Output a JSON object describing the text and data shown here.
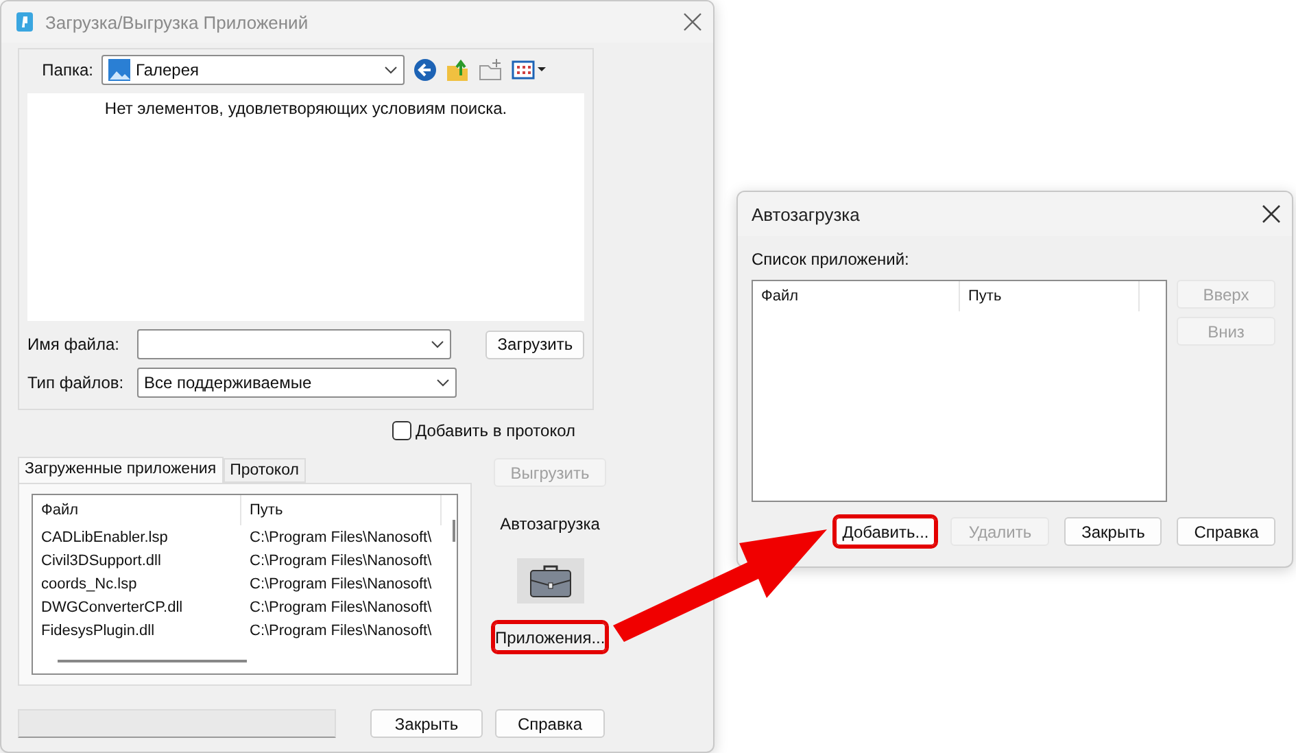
{
  "main_window": {
    "title": "Загрузка/Выгрузка Приложений",
    "folder": {
      "label": "Папка:",
      "value": "Галерея"
    },
    "empty_message": "Нет элементов, удовлетворяющих условиям поиска.",
    "file_name": {
      "label": "Имя файла:"
    },
    "load_button": "Загрузить",
    "file_type": {
      "label": "Тип файлов:",
      "value": "Все поддерживаемые"
    },
    "add_to_log": {
      "label": "Добавить в протокол",
      "checked": false
    },
    "tabs": [
      {
        "label": "Загруженные приложения",
        "selected": true
      },
      {
        "label": "Протокол",
        "selected": false
      }
    ],
    "table": {
      "columns": [
        "Файл",
        "Путь"
      ],
      "rows": [
        {
          "file": "CADLibEnabler.lsp",
          "path": "C:\\Program Files\\Nanosoft\\"
        },
        {
          "file": "Civil3DSupport.dll",
          "path": "C:\\Program Files\\Nanosoft\\"
        },
        {
          "file": "coords_Nc.lsp",
          "path": "C:\\Program Files\\Nanosoft\\"
        },
        {
          "file": "DWGConverterCP.dll",
          "path": "C:\\Program Files\\Nanosoft\\"
        },
        {
          "file": "FidesysPlugin.dll",
          "path": "C:\\Program Files\\Nanosoft\\"
        }
      ]
    },
    "unload_button": {
      "label": "Выгрузить",
      "disabled": true
    },
    "autoload_label": "Автозагрузка",
    "apps_button": {
      "label": "Приложения...",
      "highlighted": true
    },
    "progress": {
      "level": 0
    },
    "buttons": [
      "Закрыть",
      "Справка"
    ]
  },
  "autoload_window": {
    "title": "Автозагрузка",
    "list_label": "Список приложений:",
    "columns": [
      "Файл",
      "Путь"
    ],
    "side_buttons": [
      {
        "label": "Вверх",
        "disabled": true
      },
      {
        "label": "Вниз",
        "disabled": true
      }
    ],
    "buttons": [
      {
        "label": "Добавить...",
        "disabled": false,
        "highlighted": true
      },
      {
        "label": "Удалить",
        "disabled": true,
        "highlighted": false
      },
      {
        "label": "Закрыть",
        "disabled": false,
        "highlighted": false
      },
      {
        "label": "Справка",
        "disabled": false,
        "highlighted": false
      }
    ]
  }
}
